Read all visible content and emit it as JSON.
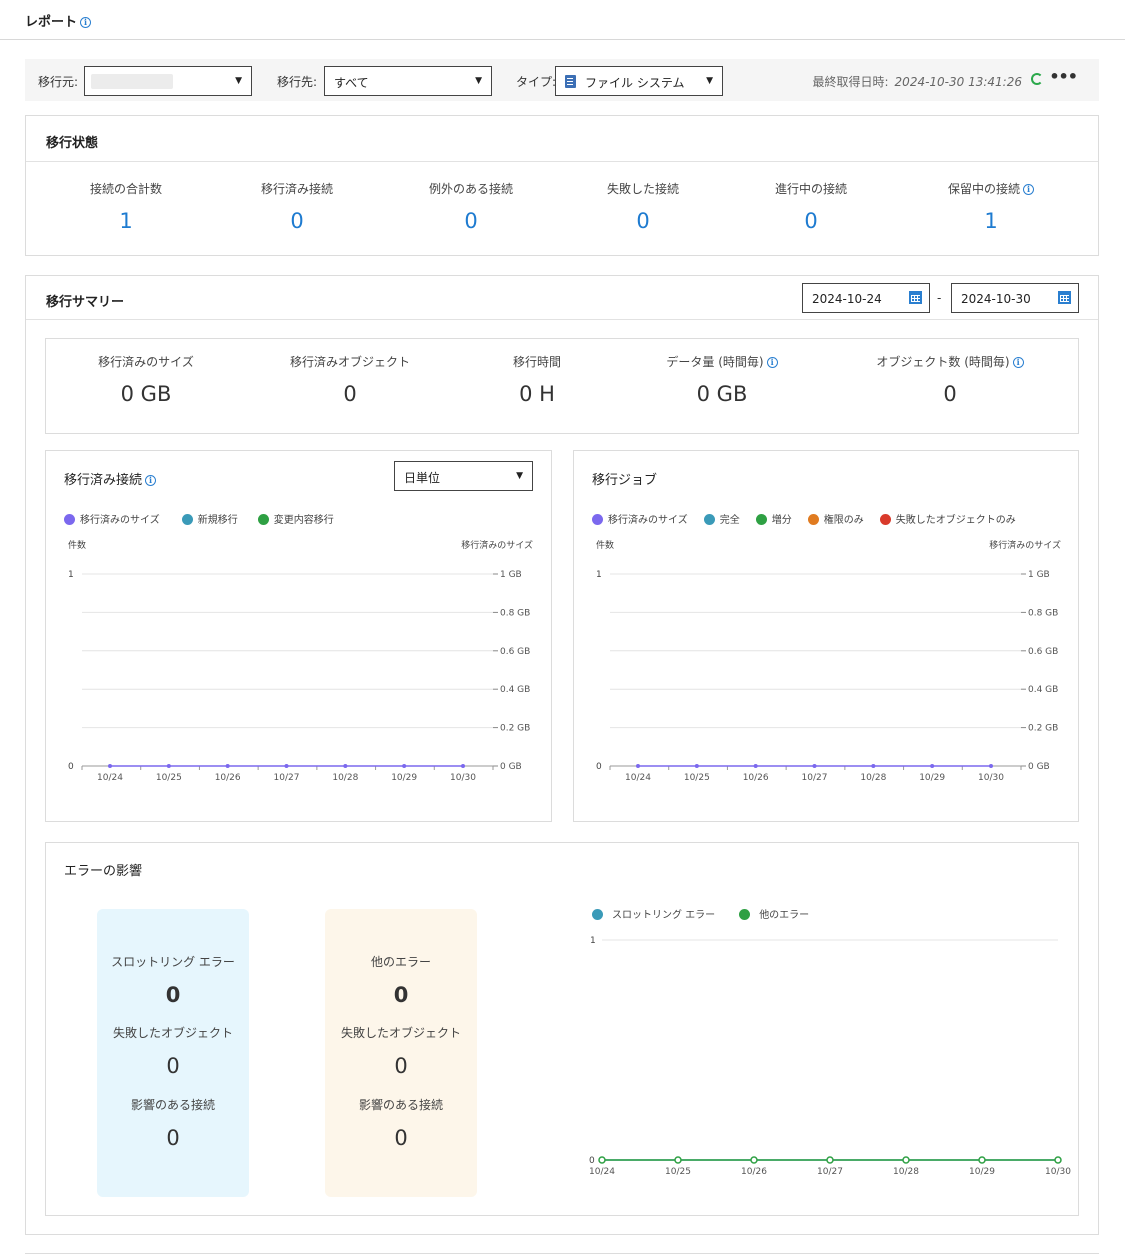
{
  "header": {
    "title": "レポート"
  },
  "filters": {
    "source_label": "移行元:",
    "dest_label": "移行先:",
    "dest_value": "すべて",
    "type_label": "タイプ:",
    "type_value": "ファイル システム",
    "last_fetched_label": "最終取得日時:",
    "last_fetched_value": "2024-10-30 13:41:26"
  },
  "migration_status": {
    "title": "移行状態",
    "stats": [
      {
        "label": "接続の合計数",
        "value": "1"
      },
      {
        "label": "移行済み接続",
        "value": "0"
      },
      {
        "label": "例外のある接続",
        "value": "0"
      },
      {
        "label": "失敗した接続",
        "value": "0"
      },
      {
        "label": "進行中の接続",
        "value": "0"
      },
      {
        "label": "保留中の接続",
        "value": "1"
      }
    ]
  },
  "summary": {
    "title": "移行サマリー",
    "date_from": "2024-10-24",
    "date_sep": "-",
    "date_to": "2024-10-30",
    "stats": [
      {
        "label": "移行済みのサイズ",
        "value": "0 GB"
      },
      {
        "label": "移行済みオブジェクト",
        "value": "0"
      },
      {
        "label": "移行時間",
        "value": "0 H"
      },
      {
        "label": "データ量 (時間毎)",
        "value": "0 GB"
      },
      {
        "label": "オブジェクト数 (時間毎)",
        "value": "0"
      }
    ]
  },
  "migrated_connections": {
    "title": "移行済み接続",
    "granularity": "日単位"
  },
  "migration_jobs": {
    "title": "移行ジョブ"
  },
  "error_impact": {
    "title": "エラーの影響",
    "throttling": {
      "label": "スロットリング エラー",
      "value": "0",
      "failed_label": "失敗したオブジェクト",
      "failed_value": "0",
      "affected_label": "影響のある接続",
      "affected_value": "0"
    },
    "other": {
      "label": "他のエラー",
      "value": "0",
      "failed_label": "失敗したオブジェクト",
      "failed_value": "0",
      "affected_label": "影響のある接続",
      "affected_value": "0"
    }
  },
  "colors": {
    "accent": "#1e7bd0",
    "throttling_bg": "#e6f6fd",
    "other_bg": "#fdf6ea"
  },
  "chart_data": [
    {
      "id": "connections",
      "type": "line",
      "left_axis_label": "件数",
      "right_axis_label": "移行済みのサイズ",
      "x": [
        "10/24",
        "10/25",
        "10/26",
        "10/27",
        "10/28",
        "10/29",
        "10/30"
      ],
      "y_left_ticks": [
        "0",
        "1"
      ],
      "y_right_ticks": [
        "0 GB",
        "0.2 GB",
        "0.4 GB",
        "0.6 GB",
        "0.8 GB",
        "1 GB"
      ],
      "ylim_left": [
        0,
        1
      ],
      "ylim_right": [
        0,
        1
      ],
      "series": [
        {
          "name": "移行済みのサイズ",
          "color": "#7b68ee",
          "values": [
            0,
            0,
            0,
            0,
            0,
            0,
            0
          ]
        },
        {
          "name": "新規移行",
          "color": "#3a9ab8",
          "values": []
        },
        {
          "name": "変更内容移行",
          "color": "#2ea043",
          "values": []
        }
      ]
    },
    {
      "id": "jobs",
      "type": "line",
      "left_axis_label": "件数",
      "right_axis_label": "移行済みのサイズ",
      "x": [
        "10/24",
        "10/25",
        "10/26",
        "10/27",
        "10/28",
        "10/29",
        "10/30"
      ],
      "y_left_ticks": [
        "0",
        "1"
      ],
      "y_right_ticks": [
        "0 GB",
        "0.2 GB",
        "0.4 GB",
        "0.6 GB",
        "0.8 GB",
        "1 GB"
      ],
      "ylim_left": [
        0,
        1
      ],
      "ylim_right": [
        0,
        1
      ],
      "series": [
        {
          "name": "移行済みのサイズ",
          "color": "#7b68ee",
          "values": [
            0,
            0,
            0,
            0,
            0,
            0,
            0
          ]
        },
        {
          "name": "完全",
          "color": "#3a9ab8",
          "values": []
        },
        {
          "name": "増分",
          "color": "#2ea043",
          "values": []
        },
        {
          "name": "権限のみ",
          "color": "#e07b20",
          "values": []
        },
        {
          "name": "失敗したオブジェクトのみ",
          "color": "#d93a2b",
          "values": []
        }
      ]
    },
    {
      "id": "errors",
      "type": "line",
      "x": [
        "10/24",
        "10/25",
        "10/26",
        "10/27",
        "10/28",
        "10/29",
        "10/30"
      ],
      "y_ticks": [
        "0",
        "1"
      ],
      "ylim": [
        0,
        1
      ],
      "series": [
        {
          "name": "スロットリング エラー",
          "color": "#3a9ab8",
          "values": [
            0,
            0,
            0,
            0,
            0,
            0,
            0
          ]
        },
        {
          "name": "他のエラー",
          "color": "#2ea043",
          "values": [
            0,
            0,
            0,
            0,
            0,
            0,
            0
          ]
        }
      ]
    }
  ]
}
